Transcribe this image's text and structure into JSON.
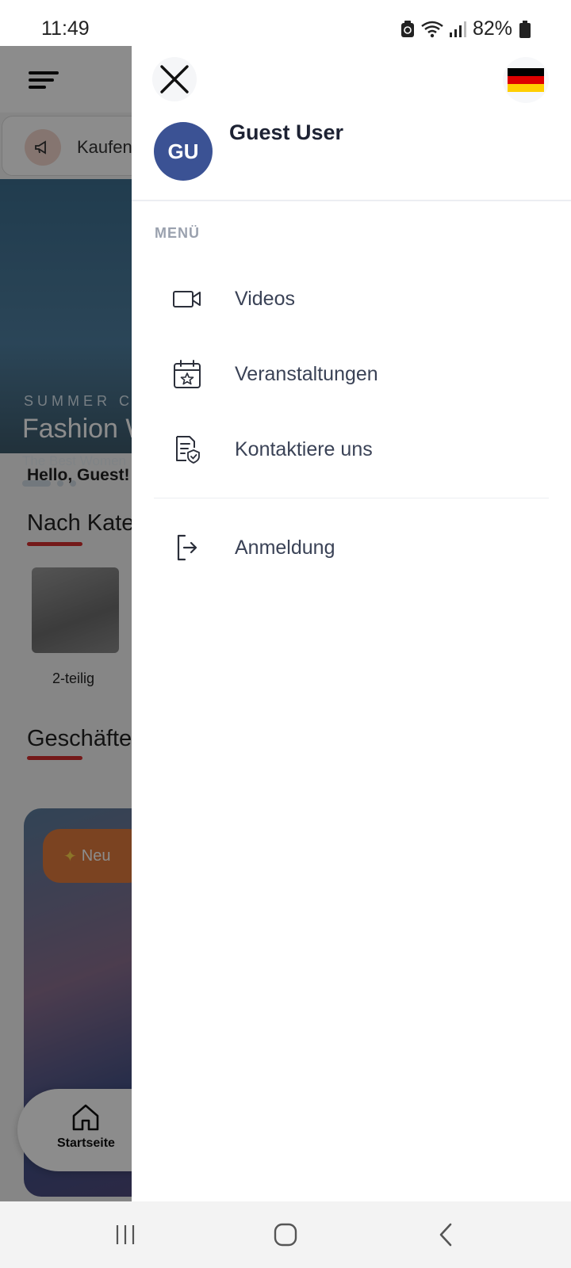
{
  "status_bar": {
    "time": "11:49",
    "battery": "82%",
    "icons": [
      "battery-saver-icon",
      "wifi-icon",
      "signal-icon",
      "battery-icon"
    ]
  },
  "background_app": {
    "promo_text": "Kaufen",
    "hero": {
      "caption": "SUMMER C",
      "title": "Fashion W",
      "subtitle": "The Best Women"
    },
    "greeting": "Hello, Guest!",
    "category_section_title": "Nach Kate",
    "category_label": "2-teilig",
    "shops_section_title": "Geschäfte",
    "new_badge": "Neu",
    "nav_home_label": "Startseite"
  },
  "drawer": {
    "avatar_initials": "GU",
    "user_name": "Guest User",
    "menu_heading": "MENÜ",
    "items": [
      {
        "label": "Videos",
        "icon": "video-camera-icon"
      },
      {
        "label": "Veranstaltungen",
        "icon": "calendar-star-icon"
      },
      {
        "label": "Kontaktiere uns",
        "icon": "contact-document-icon"
      }
    ],
    "login_label": "Anmeldung",
    "language_flag": "germany-flag-icon"
  },
  "colors": {
    "avatar_bg": "#3b5294",
    "accent_red": "#d32f2f",
    "scrim": "rgba(0,0,0,0.45)"
  }
}
